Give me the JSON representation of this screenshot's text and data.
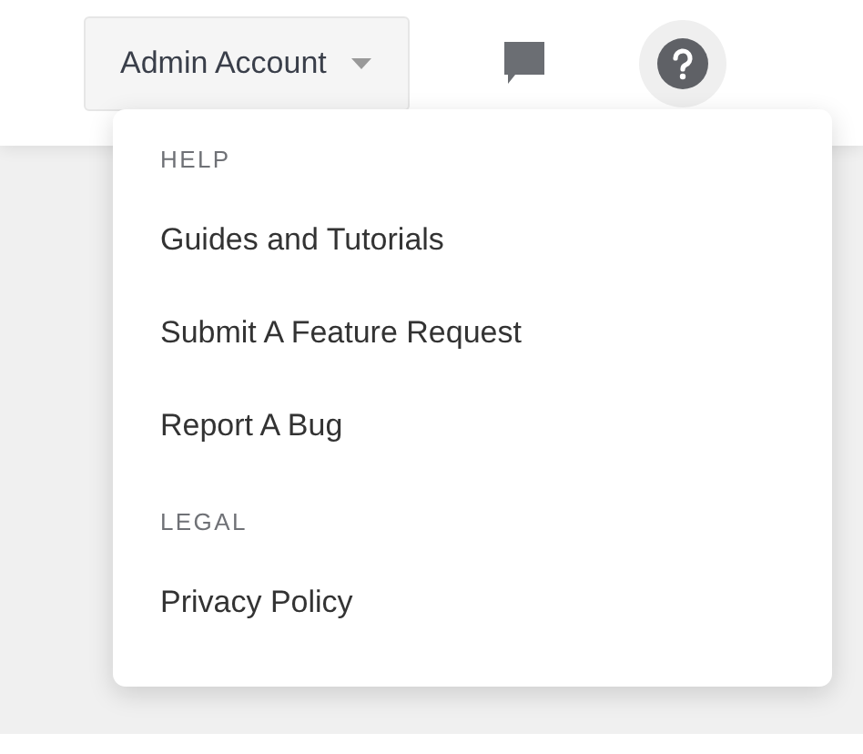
{
  "account_button": {
    "label": "Admin Account"
  },
  "help_button": {
    "active": true
  },
  "help_menu": {
    "sections": [
      {
        "heading": "HELP",
        "items": [
          "Guides and Tutorials",
          "Submit A Feature Request",
          "Report A Bug"
        ]
      },
      {
        "heading": "LEGAL",
        "items": [
          "Privacy Policy"
        ]
      }
    ]
  }
}
